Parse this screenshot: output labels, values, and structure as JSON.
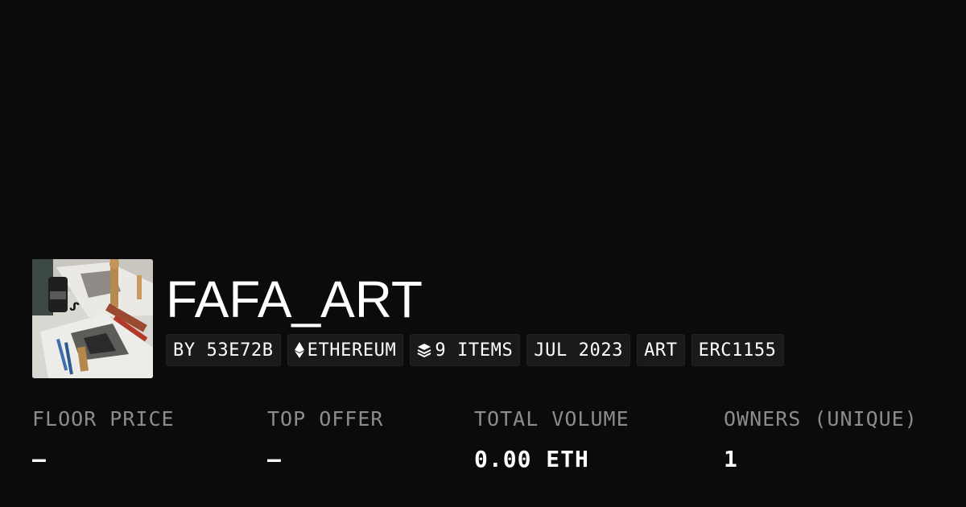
{
  "collection": {
    "title": "FAFA_ART",
    "thumbnail_alt": "collection thumbnail",
    "badges": {
      "creator": "BY 53E72B",
      "chain": "ETHEREUM",
      "items": "9 ITEMS",
      "date": "JUL 2023",
      "category": "ART",
      "standard": "ERC1155"
    }
  },
  "stats": {
    "floor_price": {
      "label": "FLOOR PRICE",
      "value": "–"
    },
    "top_offer": {
      "label": "TOP OFFER",
      "value": "–"
    },
    "total_volume": {
      "label": "TOTAL VOLUME",
      "value": "0.00 ETH"
    },
    "owners": {
      "label": "OWNERS (UNIQUE)",
      "value": "1"
    }
  },
  "icons": {
    "chain": "ethereum-icon",
    "items": "layers-icon"
  },
  "colors": {
    "background": "#0b0b0b",
    "badge_bg": "#1a1a1a",
    "label": "#8c8c8c",
    "text": "#ffffff"
  }
}
